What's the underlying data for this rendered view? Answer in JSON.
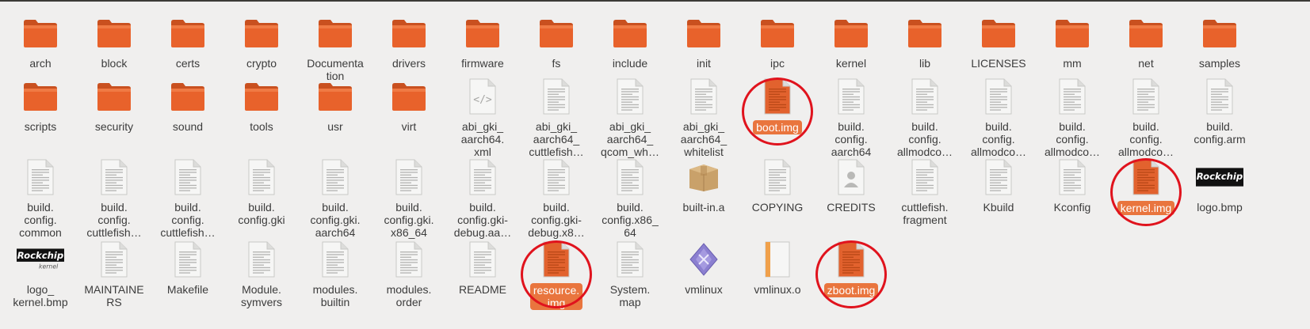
{
  "files": [
    {
      "label": "arch",
      "icon": "folder-icon"
    },
    {
      "label": "block",
      "icon": "folder-icon"
    },
    {
      "label": "certs",
      "icon": "folder-icon"
    },
    {
      "label": "crypto",
      "icon": "folder-icon"
    },
    {
      "label": "Documenta\ntion",
      "icon": "folder-icon"
    },
    {
      "label": "drivers",
      "icon": "folder-icon"
    },
    {
      "label": "firmware",
      "icon": "folder-icon"
    },
    {
      "label": "fs",
      "icon": "folder-icon"
    },
    {
      "label": "include",
      "icon": "folder-icon"
    },
    {
      "label": "init",
      "icon": "folder-icon"
    },
    {
      "label": "ipc",
      "icon": "folder-icon"
    },
    {
      "label": "kernel",
      "icon": "folder-icon"
    },
    {
      "label": "lib",
      "icon": "folder-icon"
    },
    {
      "label": "LICENSES",
      "icon": "folder-icon"
    },
    {
      "label": "mm",
      "icon": "folder-icon"
    },
    {
      "label": "net",
      "icon": "folder-icon"
    },
    {
      "label": "samples",
      "icon": "folder-icon"
    },
    {
      "label": "scripts",
      "icon": "folder-icon"
    },
    {
      "label": "security",
      "icon": "folder-icon"
    },
    {
      "label": "sound",
      "icon": "folder-icon"
    },
    {
      "label": "tools",
      "icon": "folder-icon"
    },
    {
      "label": "usr",
      "icon": "folder-icon"
    },
    {
      "label": "virt",
      "icon": "folder-icon"
    },
    {
      "label": "abi_gki_\naarch64.\nxml",
      "icon": "xml-file-icon"
    },
    {
      "label": "abi_gki_\naarch64_\ncuttlefish…",
      "icon": "text-file-icon"
    },
    {
      "label": "abi_gki_\naarch64_\nqcom_wh…",
      "icon": "text-file-icon"
    },
    {
      "label": "abi_gki_\naarch64_\nwhitelist",
      "icon": "text-file-icon"
    },
    {
      "label": "boot.img",
      "icon": "disk-image-icon",
      "selected": true,
      "circled": true
    },
    {
      "label": "build.\nconfig.\naarch64",
      "icon": "text-file-icon"
    },
    {
      "label": "build.\nconfig.\nallmodco…",
      "icon": "text-file-icon"
    },
    {
      "label": "build.\nconfig.\nallmodco…",
      "icon": "text-file-icon"
    },
    {
      "label": "build.\nconfig.\nallmodco…",
      "icon": "text-file-icon"
    },
    {
      "label": "build.\nconfig.\nallmodco…",
      "icon": "text-file-icon"
    },
    {
      "label": "build.\nconfig.arm",
      "icon": "text-file-icon"
    },
    {
      "label": "build.\nconfig.\ncommon",
      "icon": "text-file-icon"
    },
    {
      "label": "build.\nconfig.\ncuttlefish…",
      "icon": "text-file-icon"
    },
    {
      "label": "build.\nconfig.\ncuttlefish…",
      "icon": "text-file-icon"
    },
    {
      "label": "build.\nconfig.gki",
      "icon": "text-file-icon"
    },
    {
      "label": "build.\nconfig.gki.\naarch64",
      "icon": "text-file-icon"
    },
    {
      "label": "build.\nconfig.gki.\nx86_64",
      "icon": "text-file-icon"
    },
    {
      "label": "build.\nconfig.gki-\ndebug.aa…",
      "icon": "text-file-icon"
    },
    {
      "label": "build.\nconfig.gki-\ndebug.x8…",
      "icon": "text-file-icon"
    },
    {
      "label": "build.\nconfig.x86_\n64",
      "icon": "text-file-icon"
    },
    {
      "label": "built-in.a",
      "icon": "archive-box-icon"
    },
    {
      "label": "COPYING",
      "icon": "text-file-icon"
    },
    {
      "label": "CREDITS",
      "icon": "contacts-file-icon"
    },
    {
      "label": "cuttlefish.\nfragment",
      "icon": "text-file-icon"
    },
    {
      "label": "Kbuild",
      "icon": "text-file-icon"
    },
    {
      "label": "Kconfig",
      "icon": "text-file-icon"
    },
    {
      "label": "kernel.img",
      "icon": "disk-image-icon",
      "selected": true,
      "circled": true
    },
    {
      "label": "logo.bmp",
      "icon": "rockchip-logo-thumbnail"
    },
    {
      "label": "logo_\nkernel.bmp",
      "icon": "rockchip-kernel-logo-thumbnail"
    },
    {
      "label": "MAINTAINE\nRS",
      "icon": "text-file-icon"
    },
    {
      "label": "Makefile",
      "icon": "text-file-icon"
    },
    {
      "label": "Module.\nsymvers",
      "icon": "text-file-icon"
    },
    {
      "label": "modules.\nbuiltin",
      "icon": "text-file-icon"
    },
    {
      "label": "modules.\norder",
      "icon": "text-file-icon"
    },
    {
      "label": "README",
      "icon": "text-file-icon"
    },
    {
      "label": "resource.\nimg",
      "icon": "disk-image-icon",
      "selected": true,
      "circled": true
    },
    {
      "label": "System.\nmap",
      "icon": "text-file-icon"
    },
    {
      "label": "vmlinux",
      "icon": "executable-icon"
    },
    {
      "label": "vmlinux.o",
      "icon": "object-file-icon"
    },
    {
      "label": "zboot.img",
      "icon": "disk-image-icon",
      "selected": true,
      "circled": true
    }
  ],
  "thumbnail_text": {
    "rockchip": "Rockchip",
    "kernel": "kernel"
  },
  "colors": {
    "folder": "#e8622b",
    "selection": "#e9753e",
    "annotation_circle": "#e0131d",
    "background": "#f0efee"
  }
}
